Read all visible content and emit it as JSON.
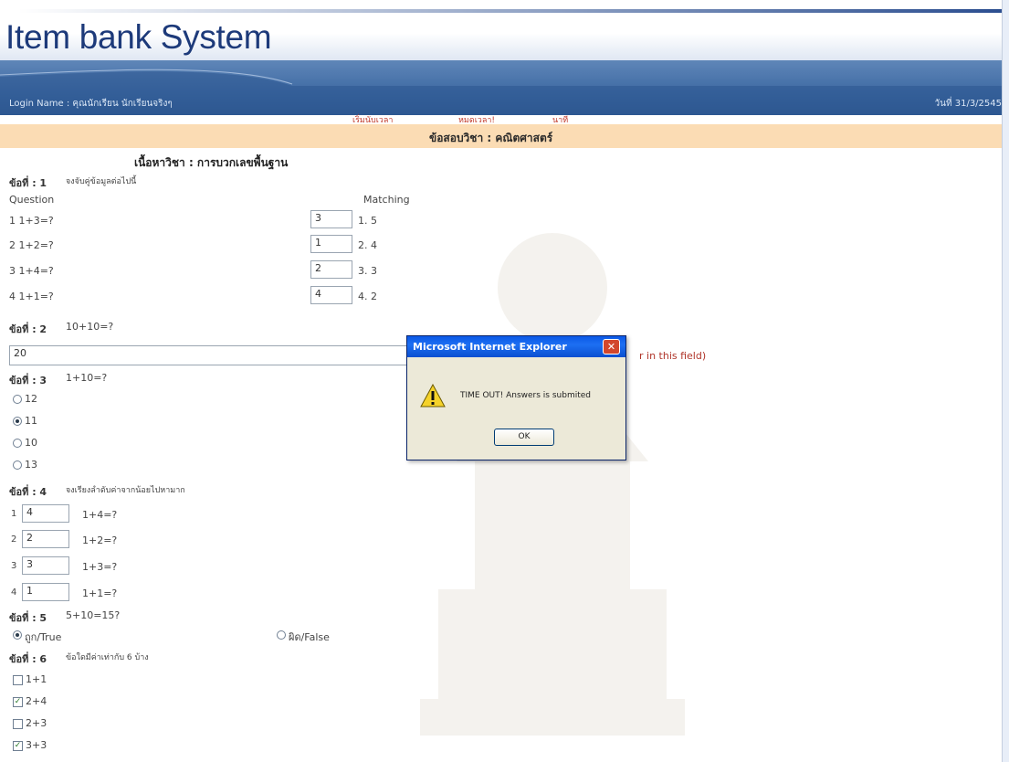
{
  "app": {
    "title": "Item bank System"
  },
  "header": {
    "login": "Login Name : คุณนักเรียน นักเรียนจริงๆ",
    "date": "วันที่ 31/3/2545",
    "nav": [
      "เริ่มนับเวลา",
      "หมดเวลา!",
      "นาที"
    ],
    "subject": "ข้อสอบวิชา : คณิตศาสตร์"
  },
  "content": {
    "topic": "เนื้อหาวิชา : การบวกเลขพื้นฐาน",
    "q1": {
      "label": "ข้อที่ : 1",
      "instruction": "จงจับคู่ข้อมูลต่อไปนี้",
      "col_question": "Question",
      "col_matching": "Matching",
      "rows": [
        {
          "q": "1  1+3=?",
          "answer": "3",
          "match": "1. 5"
        },
        {
          "q": "2  1+2=?",
          "answer": "1",
          "match": "2. 4"
        },
        {
          "q": "3  1+4=?",
          "answer": "2",
          "match": "3. 3"
        },
        {
          "q": "4  1+1=?",
          "answer": "4",
          "match": "4. 2"
        }
      ]
    },
    "q2": {
      "label": "ข้อที่ : 2",
      "text": "10+10=?",
      "answer": "20",
      "hint": "r in this field)"
    },
    "q3": {
      "label": "ข้อที่ : 3",
      "text": "1+10=?",
      "options": [
        "12",
        "11",
        "10",
        "13"
      ],
      "selected_index": 1
    },
    "q4": {
      "label": "ข้อที่ : 4",
      "instruction": "จงเรียงลำดับค่าจากน้อยไปหามาก",
      "rows": [
        {
          "n": "1",
          "answer": "4",
          "text": "1+4=?"
        },
        {
          "n": "2",
          "answer": "2",
          "text": "1+2=?"
        },
        {
          "n": "3",
          "answer": "3",
          "text": "1+3=?"
        },
        {
          "n": "4",
          "answer": "1",
          "text": "1+1=?"
        }
      ]
    },
    "q5": {
      "label": "ข้อที่ : 5",
      "text": "5+10=15?",
      "true_label": "ถูก/True",
      "false_label": "ผิด/False",
      "selected": "true"
    },
    "q6": {
      "label": "ข้อที่ : 6",
      "instruction": "ข้อใดมีค่าเท่ากับ 6 บ้าง",
      "options": [
        {
          "text": "1+1",
          "checked": false
        },
        {
          "text": "2+4",
          "checked": true
        },
        {
          "text": "2+3",
          "checked": false
        },
        {
          "text": "3+3",
          "checked": true
        }
      ]
    }
  },
  "dialog": {
    "title": "Microsoft Internet Explorer",
    "message": "TIME OUT! Answers is submited",
    "ok_label": "OK",
    "icon": "warning-icon",
    "close_icon": "close-icon"
  },
  "colors": {
    "header_blue": "#3e6aa3",
    "subject_bar": "#fbdcb4",
    "title_text": "#1d3a7a",
    "nav_red": "#c0392b"
  }
}
